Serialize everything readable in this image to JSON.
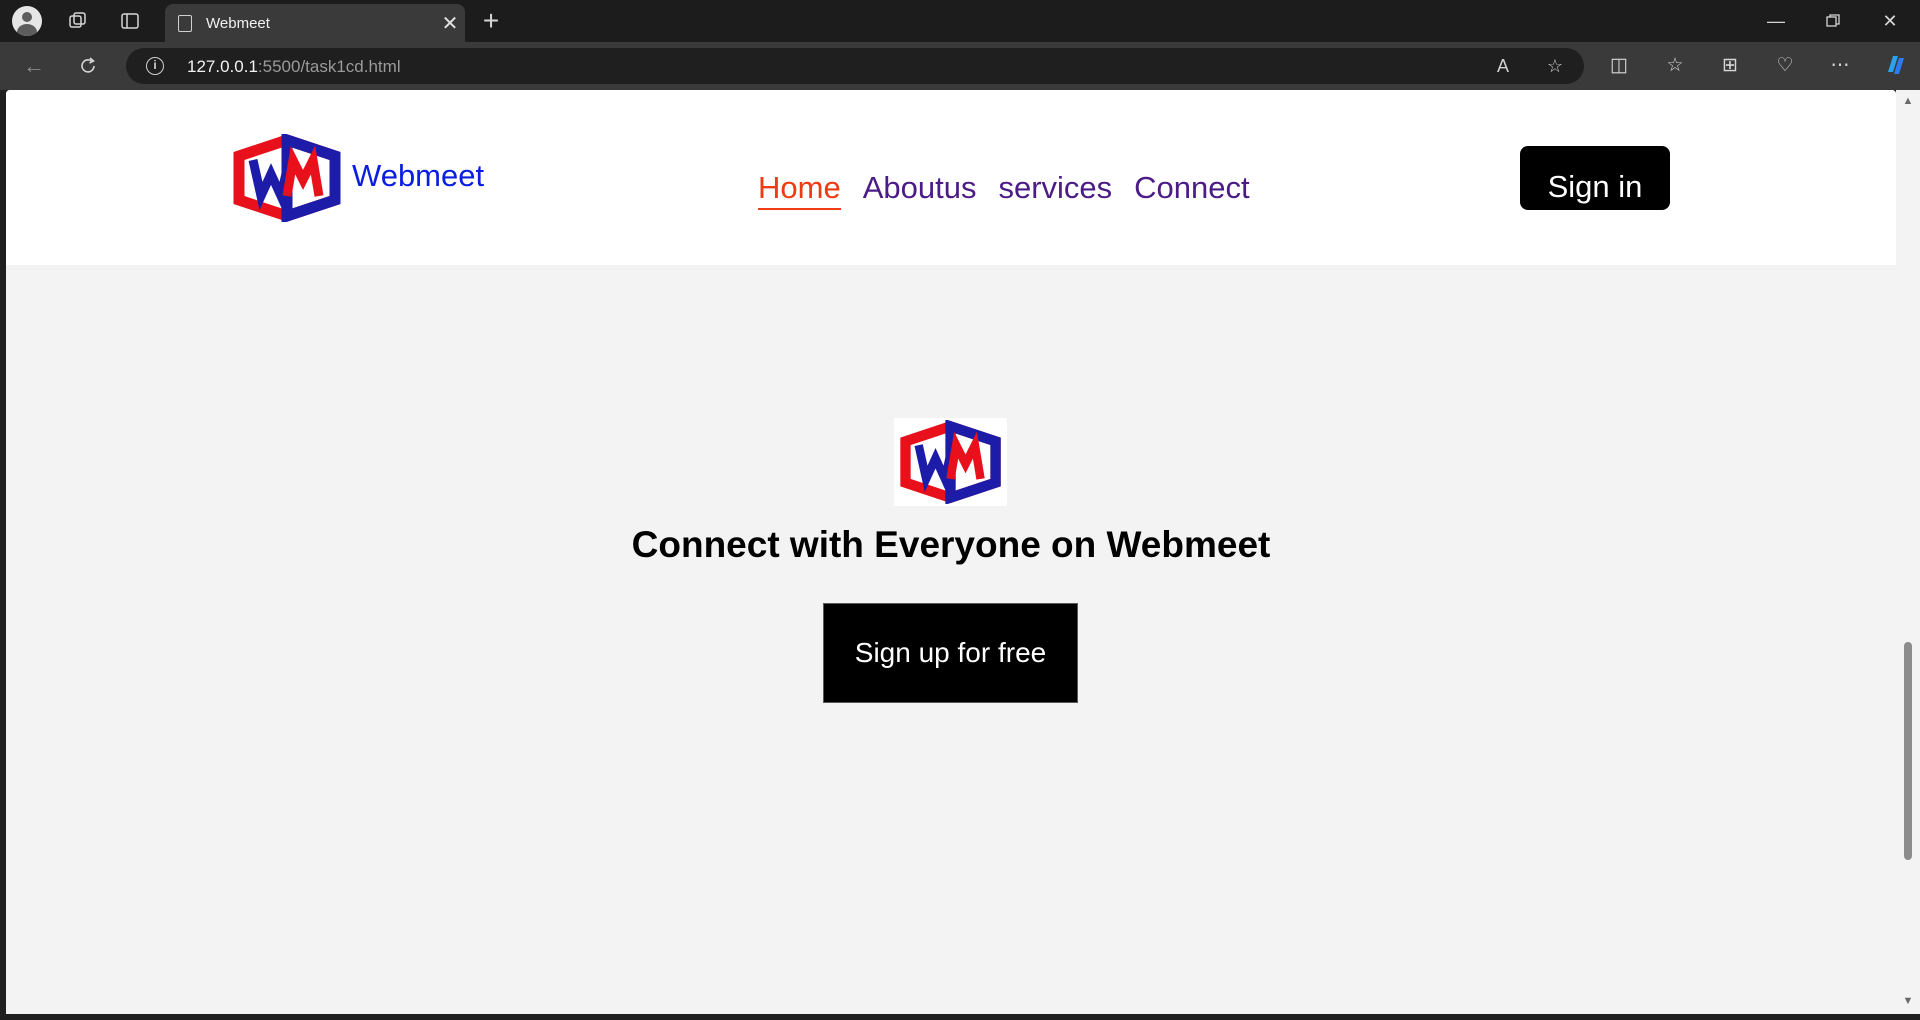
{
  "browser": {
    "tab_title": "Webmeet",
    "url_host": "127.0.0.1",
    "url_rest": ":5500/task1cd.html",
    "icons": [
      "profile-icon",
      "workspaces-icon",
      "tab-actions-icon",
      "page-icon",
      "close-tab-icon",
      "new-tab-icon",
      "minimize-icon",
      "restore-icon",
      "close-window-icon",
      "back-icon",
      "refresh-icon",
      "site-info-icon",
      "read-aloud-icon",
      "favorite-star-icon",
      "split-screen-icon",
      "favorites-icon",
      "collections-icon",
      "health-icon",
      "more-icon",
      "copilot-icon"
    ]
  },
  "header": {
    "brand_name": "Webmeet",
    "logo_letters": "WM",
    "nav": [
      {
        "label": "Home",
        "active": true
      },
      {
        "label": "Aboutus",
        "active": false
      },
      {
        "label": "services",
        "active": false
      },
      {
        "label": "Connect",
        "active": false
      }
    ],
    "signin_label": "Sign in"
  },
  "hero": {
    "title": "Connect with Everyone on Webmeet",
    "signup_label": "Sign up for free"
  },
  "colors": {
    "brand_blue": "#0a1ee0",
    "logo_red": "#e8101a",
    "logo_navy": "#1c1ca8",
    "nav_purple": "#4b1b86",
    "nav_active": "#ee3b13",
    "button_bg": "#000000",
    "page_bg": "#f3f3f3"
  }
}
